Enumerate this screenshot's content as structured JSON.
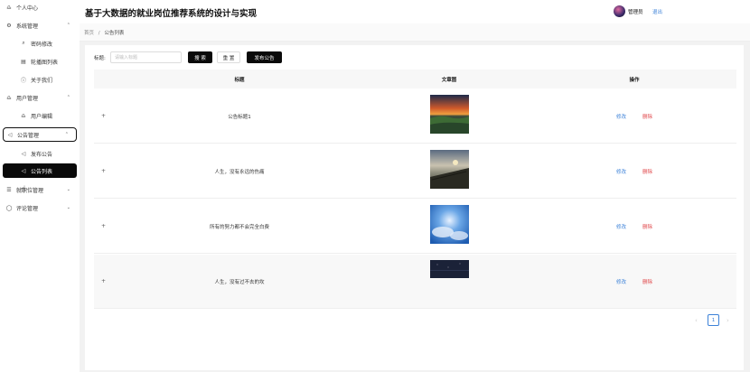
{
  "header": {
    "title": "基于大数据的就业岗位推荐系统的设计与实现",
    "admin_label": "管理员",
    "logout_label": "退出"
  },
  "sidebar": {
    "items": [
      {
        "label": "个人中心",
        "icon": "user-icon",
        "glyph": "♎"
      },
      {
        "label": "系统管理",
        "icon": "gear-icon",
        "glyph": "⚙",
        "arrow": "⌃"
      },
      {
        "label": "密码修改",
        "icon": "key-icon",
        "glyph": "⌕"
      },
      {
        "label": "轮播图列表",
        "icon": "image-icon",
        "glyph": "▤"
      },
      {
        "label": "关于我们",
        "icon": "info-icon",
        "glyph": "ⓘ"
      },
      {
        "label": "用户管理",
        "icon": "users-icon",
        "glyph": "♎",
        "arrow": "⌃"
      },
      {
        "label": "用户编辑",
        "icon": "user-icon",
        "glyph": "♎"
      },
      {
        "label": "公告管理",
        "icon": "megaphone-icon",
        "glyph": "◁",
        "arrow": "⌃"
      },
      {
        "label": "发布公告",
        "icon": "megaphone-icon",
        "glyph": "◁"
      },
      {
        "label": "公告列表",
        "icon": "megaphone-icon",
        "glyph": "◁"
      },
      {
        "label": "就职位管理",
        "icon": "list-icon",
        "glyph": "☰",
        "arrow": "⌄"
      },
      {
        "label": "评论管理",
        "icon": "comment-icon",
        "glyph": "◯",
        "arrow": "⌄"
      }
    ]
  },
  "breadcrumb": {
    "home": "首页",
    "separator": "/",
    "current": "公告列表"
  },
  "search": {
    "label": "标题:",
    "placeholder": "请输入标题",
    "search_button": "搜 索",
    "reset_button": "重 置",
    "publish_button": "发布公告"
  },
  "table": {
    "columns": [
      "标题",
      "文章图",
      "操作"
    ],
    "expand_glyph": "+",
    "edit_label": "修改",
    "delete_label": "删除",
    "rows": [
      {
        "title": "公告标题1",
        "image": "sunset-landscape"
      },
      {
        "title": "人生，没有永远的伤痛",
        "image": "sea-dusk-pier"
      },
      {
        "title": "所有的努力都不会完全白费",
        "image": "blue-sky-clouds"
      },
      {
        "title": "人生，没有过不去的坎",
        "image": "dark-night-sky"
      }
    ]
  },
  "pagination": {
    "prev": "‹",
    "page": "1",
    "next": "›"
  },
  "colors": {
    "accent": "#3d82d8",
    "danger": "#e0484b",
    "dark": "#0a0a0a"
  }
}
